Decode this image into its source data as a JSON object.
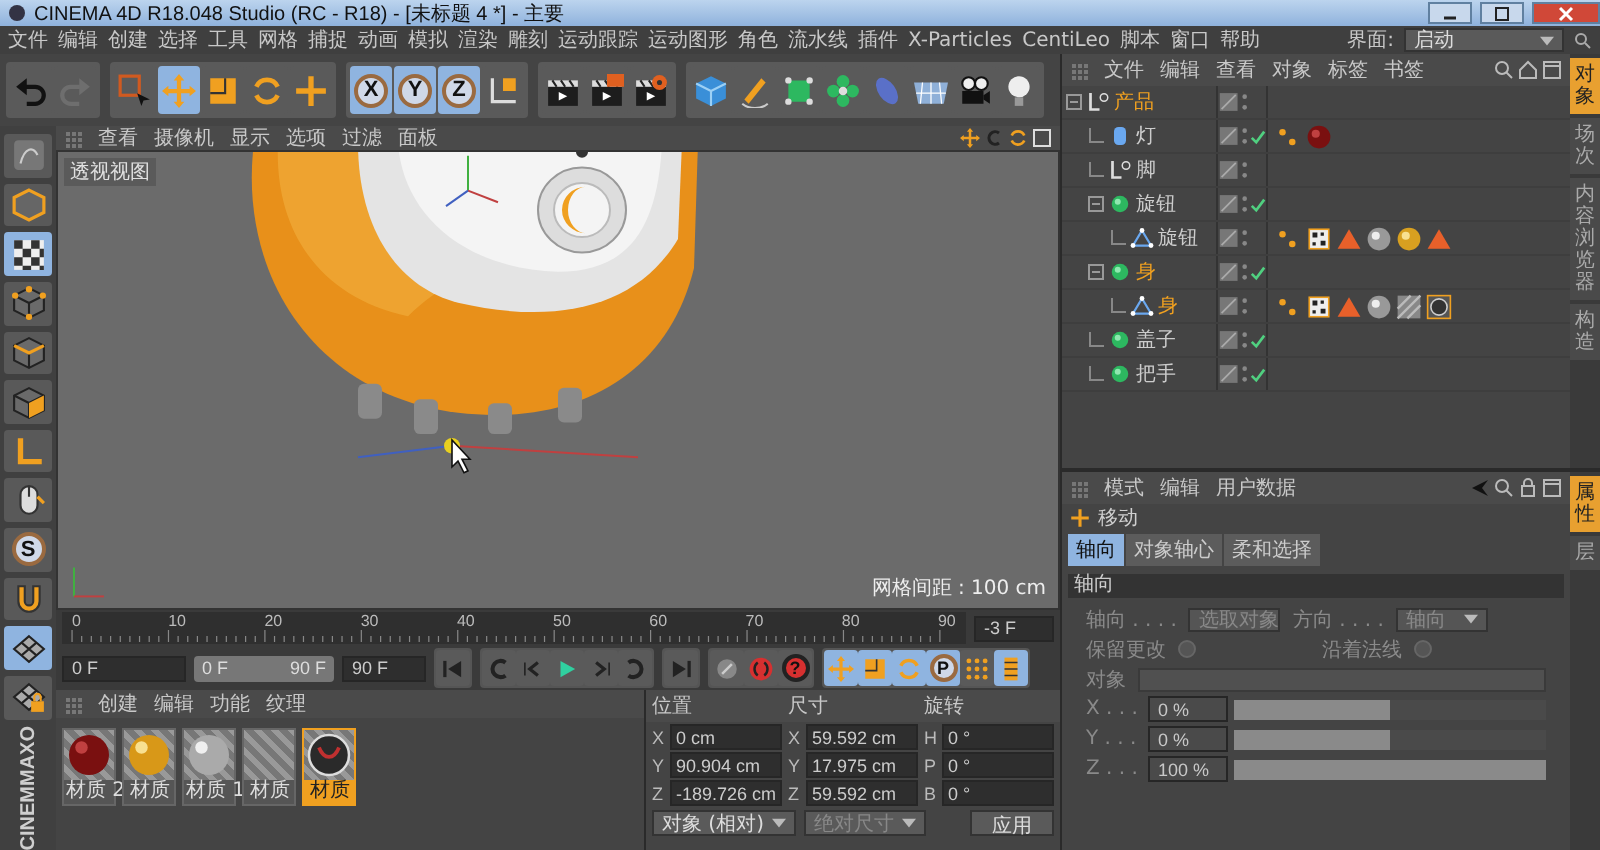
{
  "window": {
    "title": "CINEMA 4D R18.048 Studio (RC - R18) - [未标题 4 *] - 主要"
  },
  "menu": [
    "文件",
    "编辑",
    "创建",
    "选择",
    "工具",
    "网格",
    "捕捉",
    "动画",
    "模拟",
    "渲染",
    "雕刻",
    "运动跟踪",
    "运动图形",
    "角色",
    "流水线",
    "插件",
    "X-Particles",
    "CentiLeo",
    "脚本",
    "窗口",
    "帮助"
  ],
  "layout": {
    "label": "界面:",
    "value": "启动"
  },
  "toolbar": [
    [
      {
        "kind": "undo",
        "selected": false
      },
      {
        "kind": "redo",
        "selected": false
      }
    ],
    [
      {
        "kind": "select",
        "selected": false
      },
      {
        "kind": "move",
        "selected": true
      },
      {
        "kind": "scale",
        "selected": false
      },
      {
        "kind": "rotate",
        "selected": false
      },
      {
        "kind": "add",
        "selected": false
      }
    ],
    [
      {
        "kind": "axis-lock",
        "label": "X",
        "selected": true
      },
      {
        "kind": "axis-lock",
        "label": "Y",
        "selected": true
      },
      {
        "kind": "axis-lock",
        "label": "Z",
        "selected": true
      },
      {
        "kind": "coordinate-system",
        "selected": false
      }
    ],
    [
      {
        "kind": "render-view",
        "selected": false
      },
      {
        "kind": "render",
        "selected": false
      },
      {
        "kind": "render-settings",
        "selected": false
      }
    ],
    [
      {
        "kind": "cube",
        "selected": false
      },
      {
        "kind": "pen",
        "selected": false
      },
      {
        "kind": "subdivision",
        "selected": false
      },
      {
        "kind": "cloner",
        "selected": false
      },
      {
        "kind": "deformer",
        "selected": false
      },
      {
        "kind": "floor",
        "selected": false
      },
      {
        "kind": "camera",
        "selected": false
      },
      {
        "kind": "light",
        "selected": false
      }
    ]
  ],
  "left_tools": [
    {
      "kind": "sculpt",
      "selected": false
    },
    {
      "kind": "model",
      "selected": false
    },
    {
      "kind": "texture",
      "selected": true
    },
    {
      "kind": "points",
      "selected": false
    },
    {
      "kind": "edges",
      "selected": false
    },
    {
      "kind": "polygons",
      "selected": false
    },
    {
      "kind": "axis",
      "selected": false
    },
    {
      "kind": "tweak",
      "selected": false
    },
    {
      "kind": "snap",
      "label": "S",
      "selected": false
    },
    {
      "kind": "magnet",
      "selected": false
    },
    {
      "kind": "workplane",
      "selected": true
    },
    {
      "kind": "workplane-lock",
      "selected": false
    }
  ],
  "logo": [
    "MAXO",
    "CINEM"
  ],
  "viewport": {
    "menu": [
      "查看",
      "摄像机",
      "显示",
      "选项",
      "过滤",
      "面板"
    ],
    "view_label": "透视视图",
    "grid_spacing": "网格间距 : 100 cm"
  },
  "timeline": {
    "ticks": [
      "0",
      "10",
      "20",
      "30",
      "40",
      "50",
      "60",
      "70",
      "80",
      "90"
    ],
    "frame": "-3 F"
  },
  "transport": {
    "start": "0 F",
    "range_start": "0 F",
    "range_end": "90 F",
    "end": "90 F",
    "playback": [
      {
        "kind": "first"
      },
      {
        "kind": "prevkey"
      },
      {
        "kind": "stepback"
      },
      {
        "kind": "play"
      },
      {
        "kind": "stepfwd"
      },
      {
        "kind": "nextkey"
      },
      {
        "kind": "last"
      }
    ],
    "keys": [
      {
        "kind": "keyoff"
      },
      {
        "kind": "record"
      },
      {
        "kind": "autokey",
        "label": "?"
      }
    ],
    "modes": [
      {
        "kind": "move",
        "selected": true
      },
      {
        "kind": "scale",
        "selected": true
      },
      {
        "kind": "rotate",
        "selected": true
      },
      {
        "kind": "param",
        "label": "P",
        "selected": true
      },
      {
        "kind": "dots",
        "selected": false
      },
      {
        "kind": "film",
        "selected": true
      }
    ]
  },
  "materials": {
    "menu": [
      "创建",
      "编辑",
      "功能",
      "纹理"
    ],
    "items": [
      {
        "name": "材质 2",
        "kind": "red",
        "selected": false
      },
      {
        "name": "材质",
        "kind": "gold",
        "selected": false
      },
      {
        "name": "材质 1",
        "kind": "silver",
        "selected": false
      },
      {
        "name": "材质",
        "kind": "hatch",
        "selected": false
      },
      {
        "name": "材质",
        "kind": "texture",
        "selected": true
      }
    ]
  },
  "coordinates": {
    "columns": [
      {
        "title": "位置",
        "fields": [
          {
            "axis": "X",
            "value": "0 cm"
          },
          {
            "axis": "Y",
            "value": "90.904 cm"
          },
          {
            "axis": "Z",
            "value": "-189.726 cm"
          }
        ]
      },
      {
        "title": "尺寸",
        "fields": [
          {
            "axis": "X",
            "value": "59.592 cm"
          },
          {
            "axis": "Y",
            "value": "17.975 cm"
          },
          {
            "axis": "Z",
            "value": "59.592 cm"
          }
        ]
      },
      {
        "title": "旋转",
        "fields": [
          {
            "axis": "H",
            "value": "0 °"
          },
          {
            "axis": "P",
            "value": "0 °"
          },
          {
            "axis": "B",
            "value": "0 °"
          }
        ]
      }
    ],
    "mode": "对象 (相对)",
    "size_mode": "绝对尺寸",
    "apply": "应用"
  },
  "objects": {
    "menu": [
      "文件",
      "编辑",
      "查看",
      "对象",
      "标签",
      "书签"
    ],
    "tree": [
      {
        "name": "产品",
        "kind": "null",
        "selected": true,
        "checked": false,
        "children": [
          {
            "name": "灯",
            "kind": "light",
            "selected": false,
            "checked": true,
            "tags": [
              {
                "kind": "dots"
              },
              {
                "kind": "sphere-red"
              }
            ]
          },
          {
            "name": "脚",
            "kind": "null",
            "selected": false,
            "checked": false
          },
          {
            "name": "旋钮",
            "kind": "lathe",
            "selected": false,
            "checked": true,
            "children": [
              {
                "name": "旋钮",
                "kind": "polygon",
                "selected": false,
                "checked": false,
                "tags": [
                  {
                    "kind": "dots"
                  },
                  {
                    "kind": "checker"
                  },
                  {
                    "kind": "triangle"
                  },
                  {
                    "kind": "sphere-grey"
                  },
                  {
                    "kind": "sphere-gold"
                  },
                  {
                    "kind": "triangle"
                  }
                ]
              }
            ]
          },
          {
            "name": "身",
            "kind": "lathe",
            "selected": true,
            "checked": true,
            "children": [
              {
                "name": "身",
                "kind": "polygon",
                "selected": true,
                "checked": false,
                "tags": [
                  {
                    "kind": "dots"
                  },
                  {
                    "kind": "checker"
                  },
                  {
                    "kind": "triangle"
                  },
                  {
                    "kind": "sphere-grey"
                  },
                  {
                    "kind": "hatch"
                  },
                  {
                    "kind": "sphere-dark"
                  }
                ]
              }
            ]
          },
          {
            "name": "盖子",
            "kind": "lathe",
            "selected": false,
            "checked": true
          },
          {
            "name": "把手",
            "kind": "lathe",
            "selected": false,
            "checked": true
          }
        ]
      }
    ],
    "side_tabs": [
      {
        "label": "对象",
        "selected": true
      },
      {
        "label": "场次",
        "selected": false
      },
      {
        "label": "内容浏览器",
        "selected": false
      },
      {
        "label": "构造",
        "selected": false
      }
    ]
  },
  "attributes": {
    "menu": [
      "模式",
      "编辑",
      "用户数据"
    ],
    "tool": "移动",
    "tabs": [
      {
        "label": "轴向",
        "selected": true
      },
      {
        "label": "对象轴心",
        "selected": false
      },
      {
        "label": "柔和选择",
        "selected": false
      }
    ],
    "section": "轴向",
    "dropdowns": [
      {
        "label": "轴向 . . . .",
        "value": "选取对象"
      },
      {
        "label": "方向 . . . .",
        "value": "轴向"
      }
    ],
    "checkboxes": [
      {
        "label": "保留更改",
        "checked": false
      },
      {
        "label": "沿着法线",
        "checked": false
      }
    ],
    "link": {
      "label": "对象"
    },
    "sliders": [
      {
        "axis": "X . . .",
        "value": "0 %",
        "level": 0.5
      },
      {
        "axis": "Y . . .",
        "value": "0 %",
        "level": 0.5
      },
      {
        "axis": "Z . . .",
        "value": "100 %",
        "level": 1
      }
    ],
    "side_tabs": [
      {
        "label": "属性",
        "selected": true
      },
      {
        "label": "层",
        "selected": false
      }
    ]
  }
}
